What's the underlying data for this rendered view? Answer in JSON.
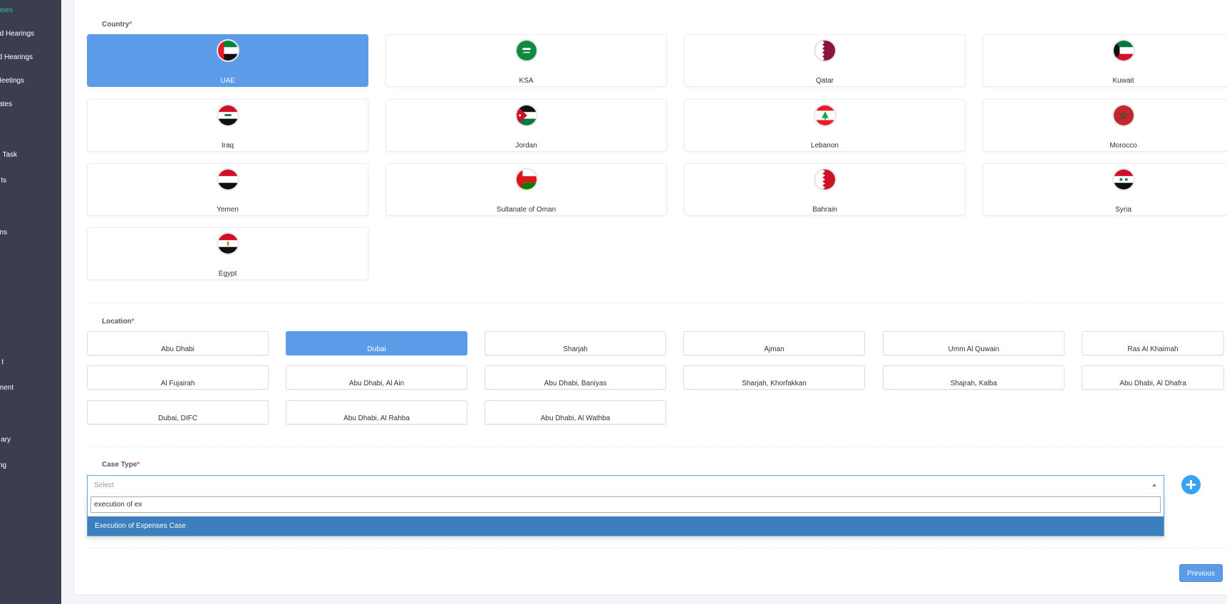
{
  "sidebar": {
    "items": [
      {
        "label": "ases",
        "active": true
      },
      {
        "label": "d Hearings"
      },
      {
        "label": "d Hearings"
      },
      {
        "label": "Meetings"
      },
      {
        "label": "ates"
      },
      {
        "label": "Task"
      },
      {
        "label": "ts"
      },
      {
        "label": "ns"
      },
      {
        "label": "t"
      },
      {
        "label": "ment"
      },
      {
        "label": "ary"
      },
      {
        "label": "ng"
      }
    ]
  },
  "country": {
    "label": "Country",
    "required": "*",
    "options": [
      {
        "name": "UAE",
        "flag": "uae-flag",
        "selected": true
      },
      {
        "name": "KSA",
        "flag": "ksa-flag"
      },
      {
        "name": "Qatar",
        "flag": "qatar-flag"
      },
      {
        "name": "Kuwait",
        "flag": "kuwait-flag"
      },
      {
        "name": "Iraq",
        "flag": "iraq-flag"
      },
      {
        "name": "Jordan",
        "flag": "jordan-flag"
      },
      {
        "name": "Lebanon",
        "flag": "lebanon-flag"
      },
      {
        "name": "Morocco",
        "flag": "morocco-flag"
      },
      {
        "name": "Yemen",
        "flag": "yemen-flag"
      },
      {
        "name": "Sultanate of Oman",
        "flag": "oman-flag"
      },
      {
        "name": "Bahrain",
        "flag": "bahrain-flag"
      },
      {
        "name": "Syria",
        "flag": "syria-flag"
      },
      {
        "name": "Egypt",
        "flag": "egypt-flag"
      }
    ]
  },
  "location": {
    "label": "Location",
    "required": "*",
    "options": [
      {
        "name": "Abu Dhabi"
      },
      {
        "name": "Dubai",
        "selected": true
      },
      {
        "name": "Sharjah"
      },
      {
        "name": "Ajman"
      },
      {
        "name": "Umm Al Quwain"
      },
      {
        "name": "Ras Al Khaimah"
      },
      {
        "name": "Al Fujairah"
      },
      {
        "name": "Abu Dhabi, Al Ain"
      },
      {
        "name": "Abu Dhabi, Baniyas"
      },
      {
        "name": "Sharjah, Khorfakkan"
      },
      {
        "name": "Shajrah, Kalba"
      },
      {
        "name": "Abu Dhabi, Al Dhafra"
      },
      {
        "name": "Dubai, DIFC"
      },
      {
        "name": "Abu Dhabi, Al Rahba"
      },
      {
        "name": "Abu Dhabi, Al Wathba"
      }
    ]
  },
  "case_type": {
    "label": "Case Type",
    "required": "*",
    "placeholder": "Select",
    "search_value": "execution of ex",
    "results": [
      "Execution of Expenses Case"
    ]
  },
  "footer": {
    "previous_label": "Previous"
  },
  "colors": {
    "sidebar_bg": "#3b3e4f",
    "accent": "#5c9be8",
    "active_green": "#34bfa3",
    "required_red": "#f4516c",
    "highlight": "#3d7fbd",
    "add_button": "#36a3f7"
  }
}
